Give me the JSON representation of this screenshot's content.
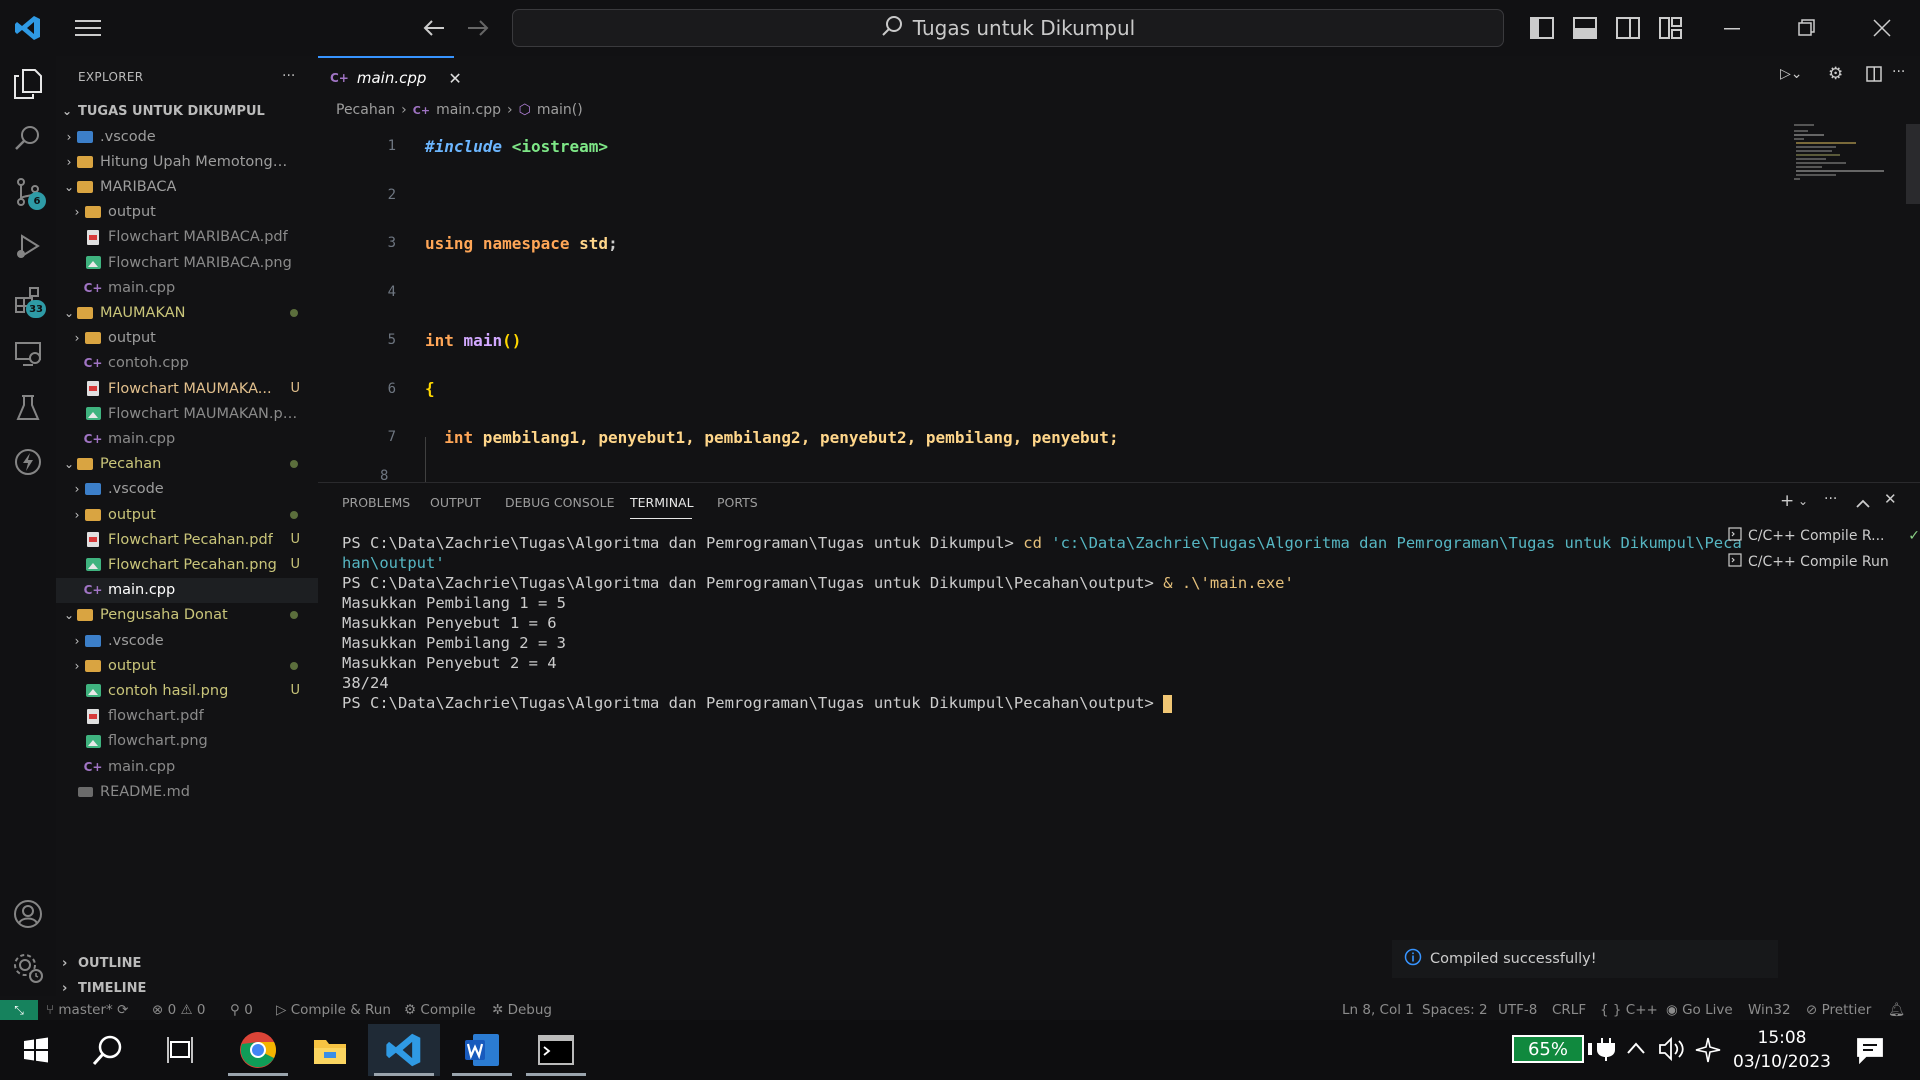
{
  "titlebar": {
    "search_text": "Tugas untuk Dikumpul"
  },
  "activity_badges": {
    "source_control": "6",
    "extensions": "33"
  },
  "sidebar": {
    "title": "EXPLORER",
    "root": "TUGAS UNTUK DIKUMPUL",
    "items": [
      {
        "label": ".vscode",
        "type": "folder-vs",
        "depth": 1,
        "chev": "›",
        "color": "#9d9d9d"
      },
      {
        "label": "Hitung Upah Memotong Ru...",
        "type": "folder",
        "depth": 1,
        "chev": "›",
        "color": "#9d9d9d"
      },
      {
        "label": "MARIBACA",
        "type": "folder",
        "depth": 1,
        "chev": "⌄",
        "color": "#9d9d9d"
      },
      {
        "label": "output",
        "type": "folder",
        "depth": 2,
        "chev": "›",
        "color": "#9d9d9d"
      },
      {
        "label": "Flowchart MARIBACA.pdf",
        "type": "pdf",
        "depth": 2,
        "chev": "",
        "color": "#8a8a8a"
      },
      {
        "label": "Flowchart MARIBACA.png",
        "type": "png",
        "depth": 2,
        "chev": "",
        "color": "#8a8a8a"
      },
      {
        "label": "main.cpp",
        "type": "cpp",
        "depth": 2,
        "chev": "",
        "color": "#8a8a8a"
      },
      {
        "label": "MAUMAKAN",
        "type": "folder",
        "depth": 1,
        "chev": "⌄",
        "color": "#c9c57a",
        "dot": true
      },
      {
        "label": "output",
        "type": "folder",
        "depth": 2,
        "chev": "›",
        "color": "#9d9d9d"
      },
      {
        "label": "contoh.cpp",
        "type": "cpp",
        "depth": 2,
        "chev": "",
        "color": "#8a8a8a"
      },
      {
        "label": "Flowchart MAUMAKA...",
        "type": "pdf",
        "depth": 2,
        "chev": "",
        "color": "#e2c08d",
        "status": "U"
      },
      {
        "label": "Flowchart MAUMAKAN.png",
        "type": "png",
        "depth": 2,
        "chev": "",
        "color": "#8a8a8a"
      },
      {
        "label": "main.cpp",
        "type": "cpp",
        "depth": 2,
        "chev": "",
        "color": "#8a8a8a"
      },
      {
        "label": "Pecahan",
        "type": "folder",
        "depth": 1,
        "chev": "⌄",
        "color": "#c9c57a",
        "dot": true
      },
      {
        "label": ".vscode",
        "type": "folder-vs",
        "depth": 2,
        "chev": "›",
        "color": "#9d9d9d"
      },
      {
        "label": "output",
        "type": "folder",
        "depth": 2,
        "chev": "›",
        "color": "#c9c57a",
        "dot": true
      },
      {
        "label": "Flowchart Pecahan.pdf",
        "type": "pdf",
        "depth": 2,
        "chev": "",
        "color": "#c9c57a",
        "status": "U"
      },
      {
        "label": "Flowchart Pecahan.png",
        "type": "png",
        "depth": 2,
        "chev": "",
        "color": "#c9c57a",
        "status": "U"
      },
      {
        "label": "main.cpp",
        "type": "cpp",
        "depth": 2,
        "chev": "",
        "color": "#ffffff",
        "selected": true
      },
      {
        "label": "Pengusaha Donat",
        "type": "folder",
        "depth": 1,
        "chev": "⌄",
        "color": "#c9c57a",
        "dot": true
      },
      {
        "label": ".vscode",
        "type": "folder-vs",
        "depth": 2,
        "chev": "›",
        "color": "#9d9d9d"
      },
      {
        "label": "output",
        "type": "folder",
        "depth": 2,
        "chev": "›",
        "color": "#c9c57a",
        "dot": true
      },
      {
        "label": "contoh hasil.png",
        "type": "png",
        "depth": 2,
        "chev": "",
        "color": "#c9c57a",
        "status": "U"
      },
      {
        "label": "flowchart.pdf",
        "type": "pdf",
        "depth": 2,
        "chev": "",
        "color": "#8a8a8a"
      },
      {
        "label": "flowchart.png",
        "type": "png",
        "depth": 2,
        "chev": "",
        "color": "#8a8a8a"
      },
      {
        "label": "main.cpp",
        "type": "cpp",
        "depth": 2,
        "chev": "",
        "color": "#8a8a8a"
      },
      {
        "label": "README.md",
        "type": "md",
        "depth": 1,
        "chev": "",
        "color": "#8a8a8a"
      }
    ],
    "outline": "OUTLINE",
    "timeline": "TIMELINE"
  },
  "editor": {
    "tab_label": "main.cpp",
    "breadcrumb": [
      "Pecahan",
      "main.cpp",
      "main()"
    ],
    "lines": [
      {
        "n": "1",
        "parts": [
          [
            "#include",
            "#6cb6ff",
            "italic"
          ],
          [
            " ",
            "#ccc"
          ],
          [
            "<iostream>",
            "#7ee787"
          ]
        ]
      },
      {
        "n": "2",
        "parts": []
      },
      {
        "n": "3",
        "parts": [
          [
            "using",
            "#ffa657"
          ],
          [
            " ",
            "#ccc"
          ],
          [
            "namespace",
            "#ffa657"
          ],
          [
            " ",
            "#ccc"
          ],
          [
            "std",
            "#ffd68a"
          ],
          [
            ";",
            "#cccccc"
          ]
        ]
      },
      {
        "n": "4",
        "parts": []
      },
      {
        "n": "5",
        "parts": [
          [
            "int",
            "#ffa657"
          ],
          [
            " ",
            "#ccc"
          ],
          [
            "main",
            "#d2a8ff"
          ],
          [
            "()",
            "#ffd700"
          ]
        ]
      },
      {
        "n": "6",
        "parts": [
          [
            "{",
            "#ffd700"
          ]
        ]
      },
      {
        "n": "7",
        "parts": [
          [
            "  int",
            "#ffa657"
          ],
          [
            " pembilang1, penyebut1, pembilang2, penyebut2, pembilang, penyebut;",
            "#ffd68a"
          ]
        ]
      }
    ]
  },
  "panel": {
    "tabs": [
      "PROBLEMS",
      "OUTPUT",
      "DEBUG CONSOLE",
      "TERMINAL",
      "PORTS"
    ],
    "active_tab": "TERMINAL",
    "terminal_lines": [
      {
        "prompt": "PS C:\\Data\\Zachrie\\Tugas\\Algoritma dan Pemrograman\\Tugas untuk Dikumpul> ",
        "cmd": "cd",
        "arg": " 'c:\\Data\\Zachrie\\Tugas\\Algoritma dan Pemrograman\\Tugas untuk Dikumpul\\Peca"
      },
      {
        "prompt": "",
        "cmd": "",
        "arg": "han\\output'"
      },
      {
        "prompt": "PS C:\\Data\\Zachrie\\Tugas\\Algoritma dan Pemrograman\\Tugas untuk Dikumpul\\Pecahan\\output> ",
        "cmd": "& .\\'main.exe'",
        "arg": ""
      },
      {
        "prompt": "Masukkan Pembilang 1 = 5",
        "cmd": "",
        "arg": ""
      },
      {
        "prompt": "Masukkan Penyebut 1 = 6",
        "cmd": "",
        "arg": ""
      },
      {
        "prompt": "Masukkan Pembilang 2 = 3",
        "cmd": "",
        "arg": ""
      },
      {
        "prompt": "Masukkan Penyebut 2 = 4",
        "cmd": "",
        "arg": ""
      },
      {
        "prompt": "38/24",
        "cmd": "",
        "arg": ""
      },
      {
        "prompt": "PS C:\\Data\\Zachrie\\Tugas\\Algoritma dan Pemrograman\\Tugas untuk Dikumpul\\Pecahan\\output> ",
        "cmd": "",
        "arg": "",
        "cursor": true
      }
    ],
    "terminals": [
      "C/C++ Compile R...",
      "C/C++ Compile Run"
    ]
  },
  "notification": "Compiled successfully!",
  "statusbar": {
    "branch": "master*",
    "errors": "0",
    "warnings": "0",
    "ports": "0",
    "compile_run": "Compile & Run",
    "compile": "Compile",
    "debug": "Debug",
    "position": "Ln 8, Col 1",
    "spaces": "Spaces: 2",
    "encoding": "UTF-8",
    "eol": "CRLF",
    "language": "C++",
    "golive": "Go Live",
    "platform": "Win32",
    "prettier": "Prettier"
  },
  "taskbar": {
    "battery": "65%",
    "time": "15:08",
    "date": "03/10/2023"
  }
}
